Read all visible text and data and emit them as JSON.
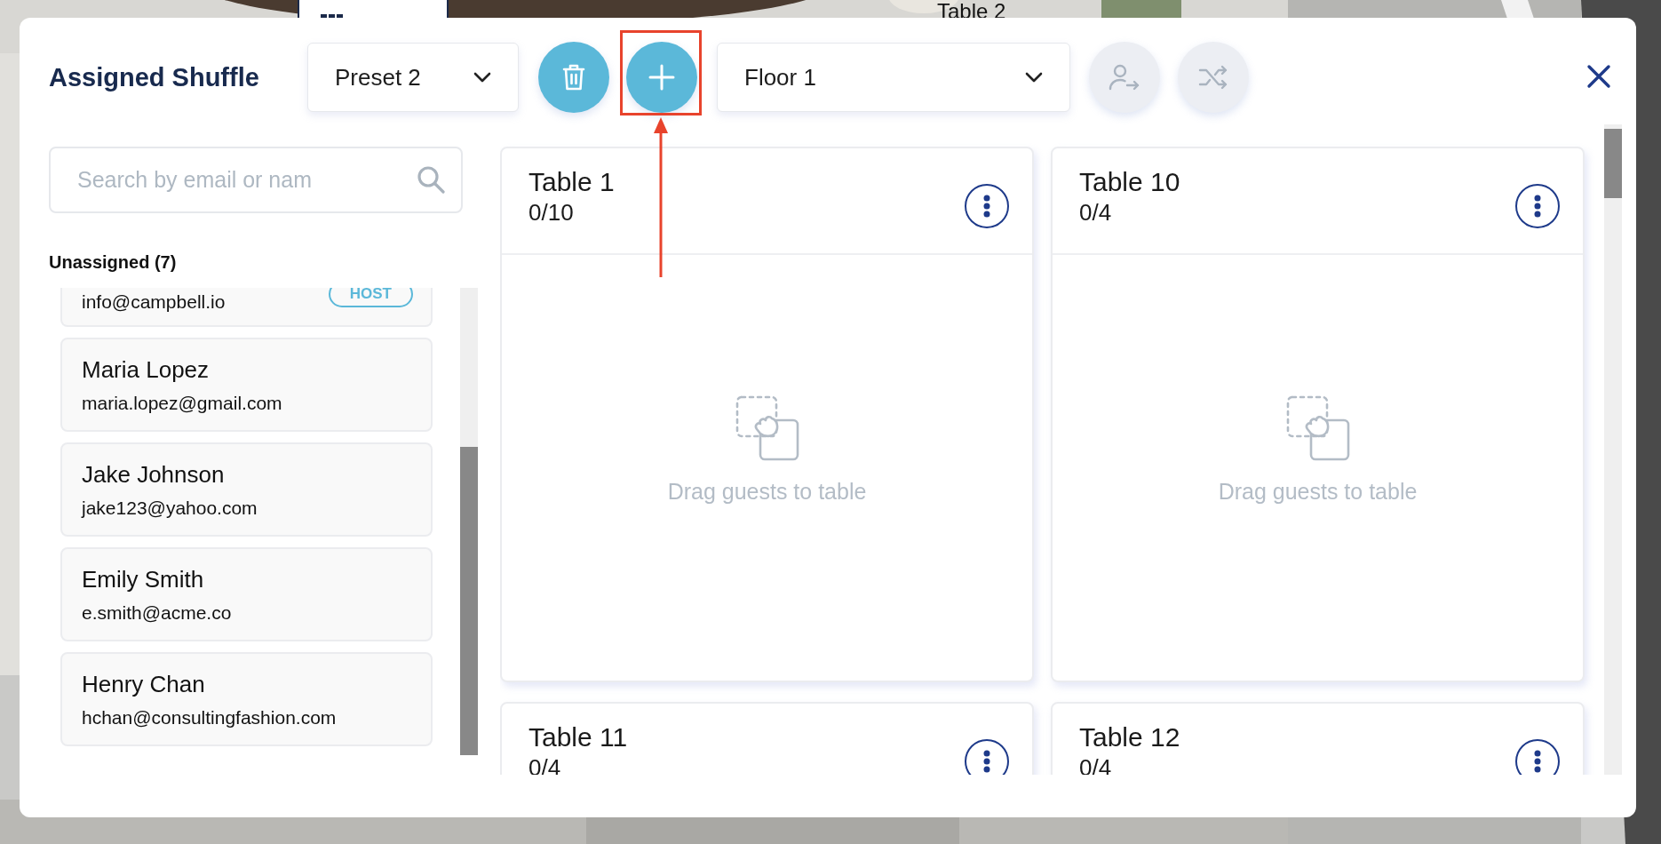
{
  "background": {
    "kind": "picture",
    "labels": [
      {
        "text": "Table 2"
      }
    ]
  },
  "dialog": {
    "title": "Assigned Shuffle",
    "toolbar": [
      {
        "kind": "select",
        "value": "Preset 2"
      },
      {
        "kind": "delete",
        "disabled": false,
        "highlighted": false
      },
      {
        "kind": "add",
        "disabled": false,
        "highlighted": true
      },
      {
        "kind": "select",
        "value": "Floor 1"
      },
      {
        "kind": "assign",
        "disabled": true,
        "highlighted": false
      },
      {
        "kind": "shuffle",
        "disabled": true,
        "highlighted": false
      }
    ],
    "search": {
      "placeholder": "Search by email or nam"
    },
    "unassigned": {
      "heading": "Unassigned (7)",
      "guests": [
        {
          "email": "info@campbell.io",
          "badge": "HOST"
        },
        {
          "name": "Maria Lopez",
          "email": "maria.lopez@gmail.com"
        },
        {
          "name": "Jake Johnson",
          "email": "jake123@yahoo.com"
        },
        {
          "name": "Emily Smith",
          "email": "e.smith@acme.co"
        },
        {
          "name": "Henry Chan",
          "email": "hchan@consultingfashion.com"
        }
      ]
    },
    "tables": [
      {
        "name": "Table 1",
        "count": "0/10",
        "empty_text": "Drag guests to table"
      },
      {
        "name": "Table 10",
        "count": "0/4",
        "empty_text": "Drag guests to table"
      },
      {
        "name": "Table 11",
        "count": "0/4"
      },
      {
        "name": "Table 12",
        "count": "0/4"
      }
    ]
  }
}
